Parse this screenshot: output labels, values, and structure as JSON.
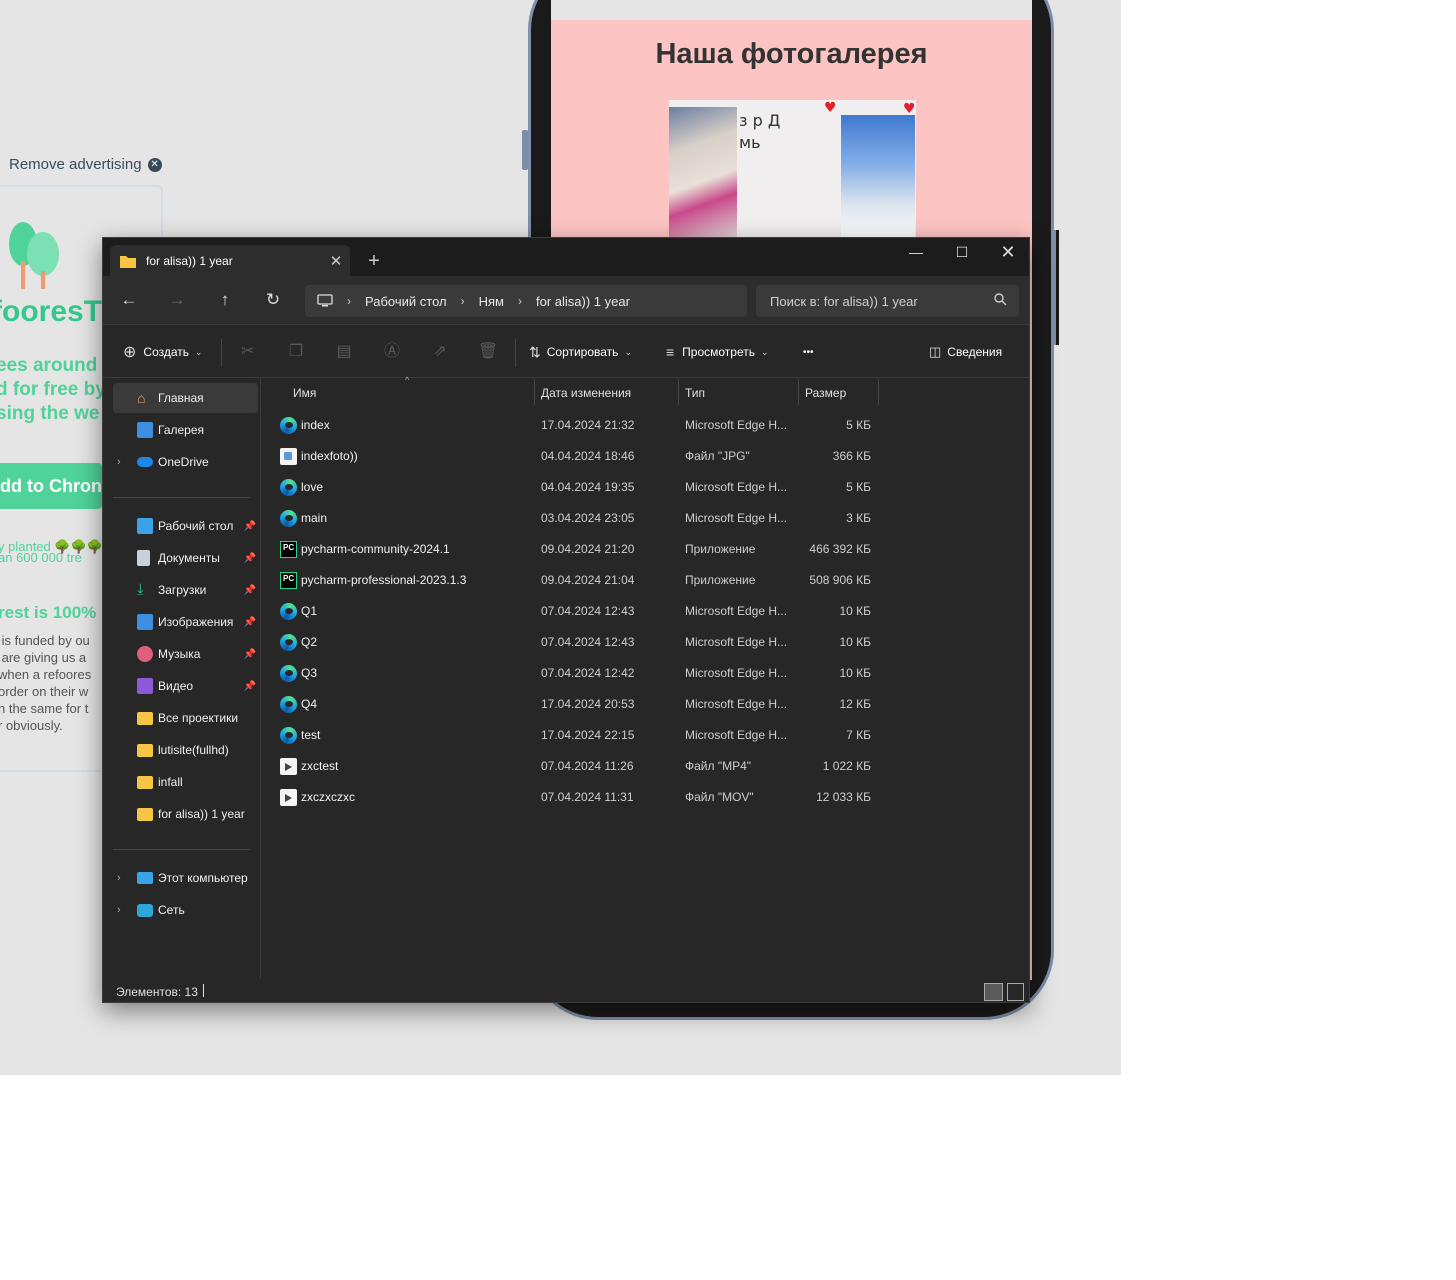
{
  "ad": {
    "remove_label": "Remove advertising",
    "brand": "fooresT",
    "tagline": "ees around\nd for free by\nsing the we",
    "button": "dd to Chron",
    "stats_line1": "an 600 000 tre",
    "stats_line2": "y planted 🌳🌳🌳",
    "headline": "rest is 100%",
    "body": " is funded by ou\n are giving us a\nwhen a refoores\norder on their w\nn the same for t\nr obviously."
  },
  "phone": {
    "gallery_title": "Наша фотогалерея",
    "doodle_text": "з р Д\nмь"
  },
  "window": {
    "tab_title": "for alisa)) 1 year",
    "new_tab": "+",
    "breadcrumb": [
      "Рабочий стол",
      "Ням",
      "for alisa)) 1 year"
    ],
    "search_placeholder": "Поиск в: for alisa)) 1 year"
  },
  "toolbar": {
    "create": "Создать",
    "sort": "Сортировать",
    "view": "Просмотреть",
    "more": "•••",
    "details": "Сведения"
  },
  "sidebar": {
    "top": [
      {
        "label": "Главная",
        "icon": "home-icon"
      },
      {
        "label": "Галерея",
        "icon": "gallery-icon"
      },
      {
        "label": "OneDrive",
        "icon": "cloud-icon"
      }
    ],
    "pinned": [
      {
        "label": "Рабочий стол",
        "icon": "desktop-icon"
      },
      {
        "label": "Документы",
        "icon": "documents-icon"
      },
      {
        "label": "Загрузки",
        "icon": "downloads-icon"
      },
      {
        "label": "Изображения",
        "icon": "pictures-icon"
      },
      {
        "label": "Музыка",
        "icon": "music-icon"
      },
      {
        "label": "Видео",
        "icon": "video-icon"
      },
      {
        "label": "Все проектики",
        "icon": "folder-icon"
      },
      {
        "label": "lutisite(fullhd)",
        "icon": "folder-icon"
      },
      {
        "label": "infall",
        "icon": "folder-icon"
      },
      {
        "label": "for alisa)) 1 year",
        "icon": "folder-icon"
      }
    ],
    "bottom": [
      {
        "label": "Этот компьютер",
        "icon": "computer-icon"
      },
      {
        "label": "Сеть",
        "icon": "network-icon"
      }
    ]
  },
  "columns": {
    "name": "Имя",
    "date": "Дата изменения",
    "type": "Тип",
    "size": "Размер"
  },
  "files": [
    {
      "name": "index",
      "date": "17.04.2024 21:32",
      "type": "Microsoft Edge H...",
      "size": "5 КБ",
      "icon": "edge"
    },
    {
      "name": "indexfoto))",
      "date": "04.04.2024 18:46",
      "type": "Файл \"JPG\"",
      "size": "366 КБ",
      "icon": "doc"
    },
    {
      "name": "love",
      "date": "04.04.2024 19:35",
      "type": "Microsoft Edge H...",
      "size": "5 КБ",
      "icon": "edge"
    },
    {
      "name": "main",
      "date": "03.04.2024 23:05",
      "type": "Microsoft Edge H...",
      "size": "3 КБ",
      "icon": "edge"
    },
    {
      "name": "pycharm-community-2024.1",
      "date": "09.04.2024 21:20",
      "type": "Приложение",
      "size": "466 392 КБ",
      "icon": "pycharm"
    },
    {
      "name": "pycharm-professional-2023.1.3",
      "date": "09.04.2024 21:04",
      "type": "Приложение",
      "size": "508 906 КБ",
      "icon": "pycharm"
    },
    {
      "name": "Q1",
      "date": "07.04.2024 12:43",
      "type": "Microsoft Edge H...",
      "size": "10 КБ",
      "icon": "edge"
    },
    {
      "name": "Q2",
      "date": "07.04.2024 12:43",
      "type": "Microsoft Edge H...",
      "size": "10 КБ",
      "icon": "edge"
    },
    {
      "name": "Q3",
      "date": "07.04.2024 12:42",
      "type": "Microsoft Edge H...",
      "size": "10 КБ",
      "icon": "edge"
    },
    {
      "name": "Q4",
      "date": "17.04.2024 20:53",
      "type": "Microsoft Edge H...",
      "size": "12 КБ",
      "icon": "edge"
    },
    {
      "name": "test",
      "date": "17.04.2024 22:15",
      "type": "Microsoft Edge H...",
      "size": "7 КБ",
      "icon": "edge"
    },
    {
      "name": "zxctest",
      "date": "07.04.2024 11:26",
      "type": "Файл \"MP4\"",
      "size": "1 022 КБ",
      "icon": "video"
    },
    {
      "name": "zxczxczxc",
      "date": "07.04.2024 11:31",
      "type": "Файл \"MOV\"",
      "size": "12 033 КБ",
      "icon": "video"
    }
  ],
  "status": {
    "count": "Элементов: 13"
  },
  "colors": {
    "accent_green": "#34c98b",
    "phone_screen": "#fcc5c3",
    "explorer_bg": "#272727"
  }
}
